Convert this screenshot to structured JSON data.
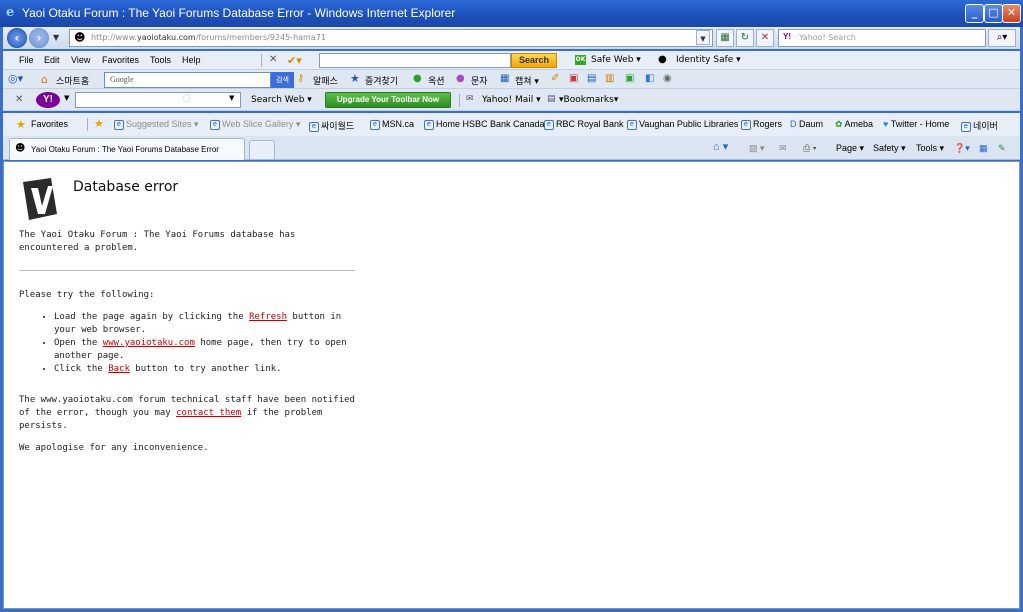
{
  "window": {
    "title": "Yaoi Otaku Forum : The Yaoi Forums Database Error - Windows Internet Explorer",
    "minimize": "_",
    "maximize": "□",
    "close": "✕"
  },
  "address_bar": {
    "url_host": "http://www.",
    "url_domain": "yaoiotaku.com",
    "url_path": "/forums/members/9245-hama71",
    "search_placeholder": "Yahoo! Search",
    "search_logo": "Y!"
  },
  "menu": {
    "file": "File",
    "edit": "Edit",
    "view": "View",
    "favorites": "Favorites",
    "tools": "Tools",
    "help": "Help",
    "search_button": "Search",
    "safe_web": "Safe Web",
    "identity_safe": "Identity Safe"
  },
  "korean_toolbar": {
    "smart_home": "스마트홈",
    "google_placeholder": "Google",
    "search_btn": "검색",
    "alpass": "알패스",
    "favorites": "즐겨찾기",
    "auction": "옥션",
    "sms": "문자",
    "capture": "캡쳐"
  },
  "yahoo_toolbar": {
    "logo": "Y!",
    "search_web": "Search Web",
    "upgrade": "Upgrade Your Toolbar Now",
    "mail": "Yahoo! Mail",
    "bookmarks": "Bookmarks"
  },
  "favorites_bar": {
    "favorites": "Favorites",
    "items": [
      "Suggested Sites",
      "Web Slice Gallery",
      "싸이월드",
      "MSN.ca",
      "Home HSBC Bank Canada",
      "RBC Royal Bank",
      "Vaughan Public Libraries",
      "Rogers",
      "Daum",
      "Ameba",
      "Twitter - Home",
      "네이버"
    ]
  },
  "tabs": {
    "active_tab": "Yaoi Otaku Forum : The Yaoi Forums Database Error",
    "page": "Page",
    "safety": "Safety",
    "tools": "Tools"
  },
  "content": {
    "heading": "Database error",
    "intro": "The Yaoi Otaku Forum : The Yaoi Forums database has encountered a problem.",
    "try_following": "Please try the following:",
    "li1_pre": "Load the page again by clicking the ",
    "li1_link": "Refresh",
    "li1_post": " button in your web browser.",
    "li2_pre": "Open the ",
    "li2_link": "www.yaoiotaku.com",
    "li2_post": " home page, then try to open another page.",
    "li3_pre": "Click the ",
    "li3_link": "Back",
    "li3_post": " button to try another link.",
    "notice_pre": "The www.yaoiotaku.com forum technical staff have been notified of the error, though you may ",
    "notice_link": "contact them",
    "notice_post": " if the problem persists.",
    "apology": "We apologise for any inconvenience."
  }
}
